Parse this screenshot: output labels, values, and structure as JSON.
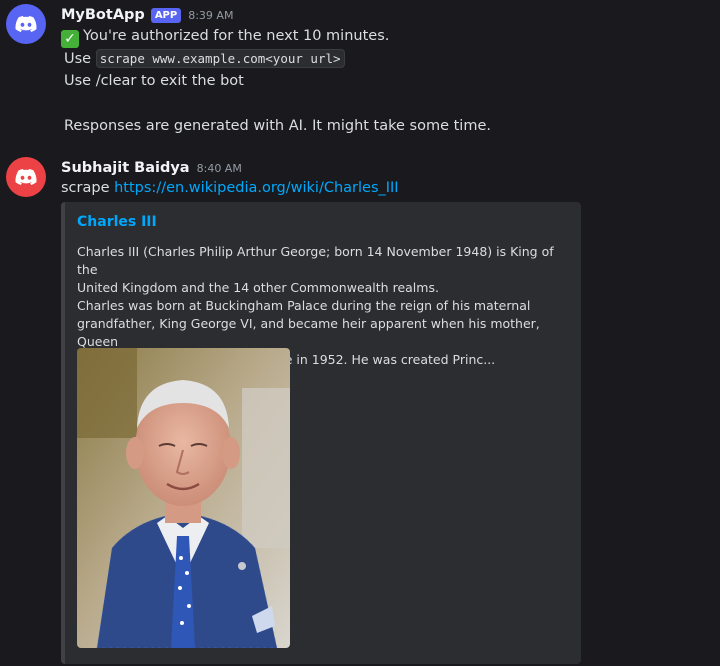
{
  "messages": [
    {
      "author": "MyBotApp",
      "badge": "APP",
      "time": "8:39 AM",
      "lines": {
        "authorized": "You're authorized for the next 10 minutes.",
        "use_prefix": "Use",
        "command_code": "scrape www.example.com<your url>",
        "clear_line": "Use /clear to exit the bot",
        "ai_note": "Responses are generated with AI. It might take some time."
      }
    },
    {
      "author": "Subhajit Baidya",
      "time": "8:40 AM",
      "command": "scrape",
      "url": "https://en.wikipedia.org/wiki/Charles_III",
      "embed": {
        "title": "Charles III",
        "description_1": "Charles III (Charles Philip Arthur George; born 14 November 1948) is King of the",
        "description_2": "United Kingdom and the 14 other Commonwealth realms.",
        "description_3": "Charles was born at Buckingham Palace during the reign of his maternal",
        "description_4": "grandfather, King George VI, and became heir apparent when his mother, Queen",
        "description_5": "Elizabeth II, acceded to the throne in 1952. He was created Princ..."
      }
    }
  ],
  "icons": {
    "bot_avatar": "discord-logo-icon",
    "user_avatar": "discord-logo-icon",
    "check": "white-check-mark-icon"
  },
  "colors": {
    "background": "#1a1a1e",
    "bot_avatar": "#5865f2",
    "user_avatar": "#ed4245",
    "link": "#00a8fc",
    "app_badge": "#5865f2"
  }
}
